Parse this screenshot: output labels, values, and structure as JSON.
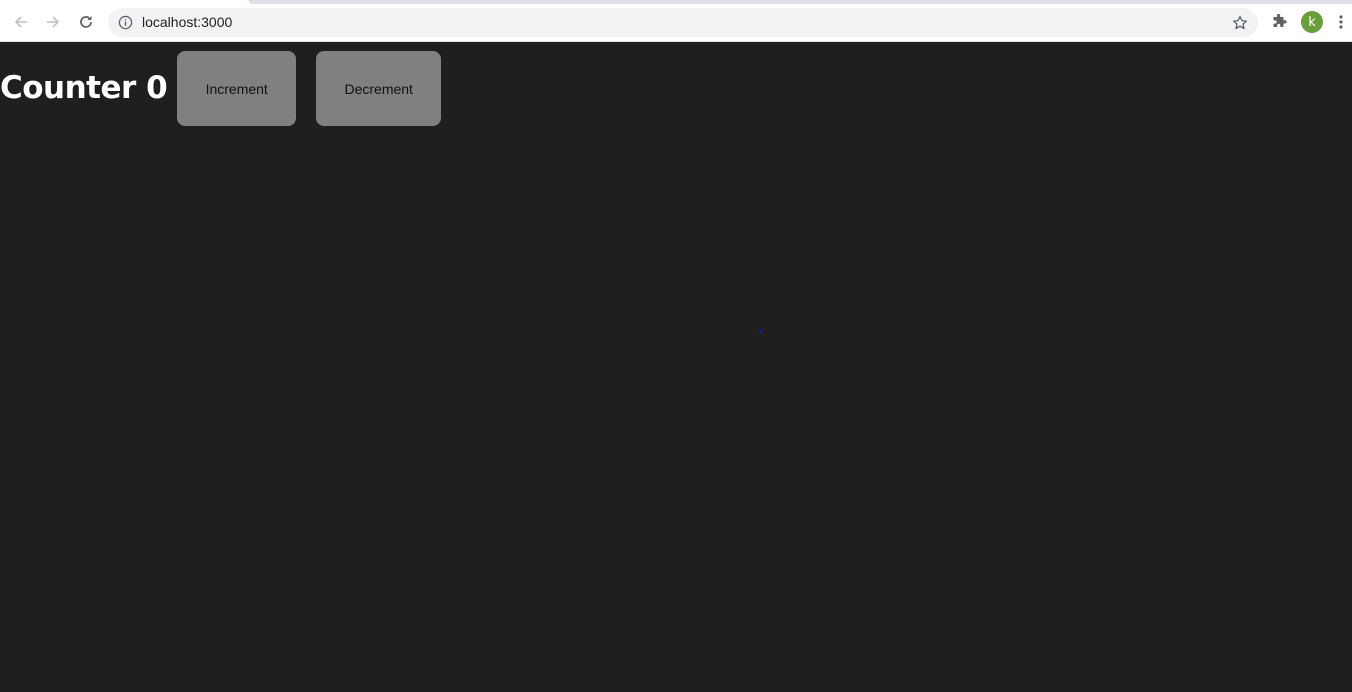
{
  "browser": {
    "url": "localhost:3000",
    "profile_initial": "k",
    "profile_color": "#689f38",
    "icons": {
      "back": "arrow-left",
      "forward": "arrow-right",
      "reload": "reload",
      "site_info": "info-circle",
      "bookmark": "star-outline",
      "extensions": "puzzle-piece",
      "menu": "vertical-dots"
    }
  },
  "app": {
    "title_label": "Counter",
    "count": "0",
    "increment_label": "Increment",
    "decrement_label": "Decrement",
    "background_color": "#1f1f1f",
    "button_color": "#808080"
  }
}
